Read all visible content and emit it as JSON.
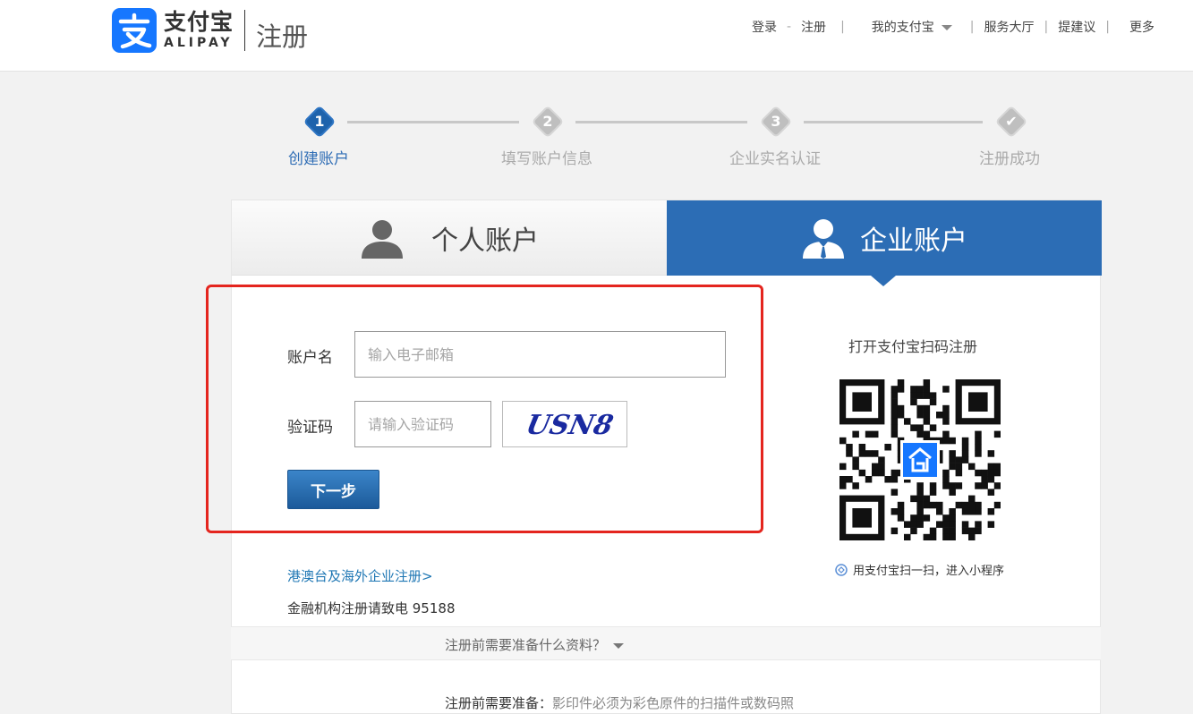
{
  "header": {
    "logo_cn": "支付宝",
    "logo_en": "ALIPAY",
    "page_name": "注册",
    "nav": {
      "login": "登录",
      "dash": "-",
      "register": "注册",
      "my_alipay": "我的支付宝",
      "service_hall": "服务大厅",
      "suggest": "提建议",
      "more": "更多",
      "separator": "|"
    }
  },
  "steps": [
    {
      "num": "1",
      "label": "创建账户",
      "active": true
    },
    {
      "num": "2",
      "label": "填写账户信息",
      "active": false
    },
    {
      "num": "3",
      "label": "企业实名认证",
      "active": false
    },
    {
      "num": "✔",
      "label": "注册成功",
      "active": false
    }
  ],
  "tabs": {
    "personal": "个人账户",
    "enterprise": "企业账户"
  },
  "form": {
    "account_label": "账户名",
    "account_placeholder": "输入电子邮箱",
    "captcha_label": "验证码",
    "captcha_placeholder": "请输入验证码",
    "captcha_text": "USN8",
    "next_button": "下一步"
  },
  "links": {
    "overseas": "港澳台及海外企业注册>",
    "financial": "金融机构注册请致电 95188"
  },
  "qr": {
    "title": "打开支付宝扫码注册",
    "caption": "用支付宝扫一扫，进入小程序"
  },
  "prep": {
    "toggle": "注册前需要准备什么资料？",
    "note_label": "注册前需要准备：",
    "note_text": "影印件必须为彩色原件的扫描件或数码照"
  },
  "colors": {
    "brand_blue": "#1677ff",
    "tab_active": "#2c6db5",
    "highlight_red": "#e4251e",
    "link_blue": "#1f77b4"
  }
}
